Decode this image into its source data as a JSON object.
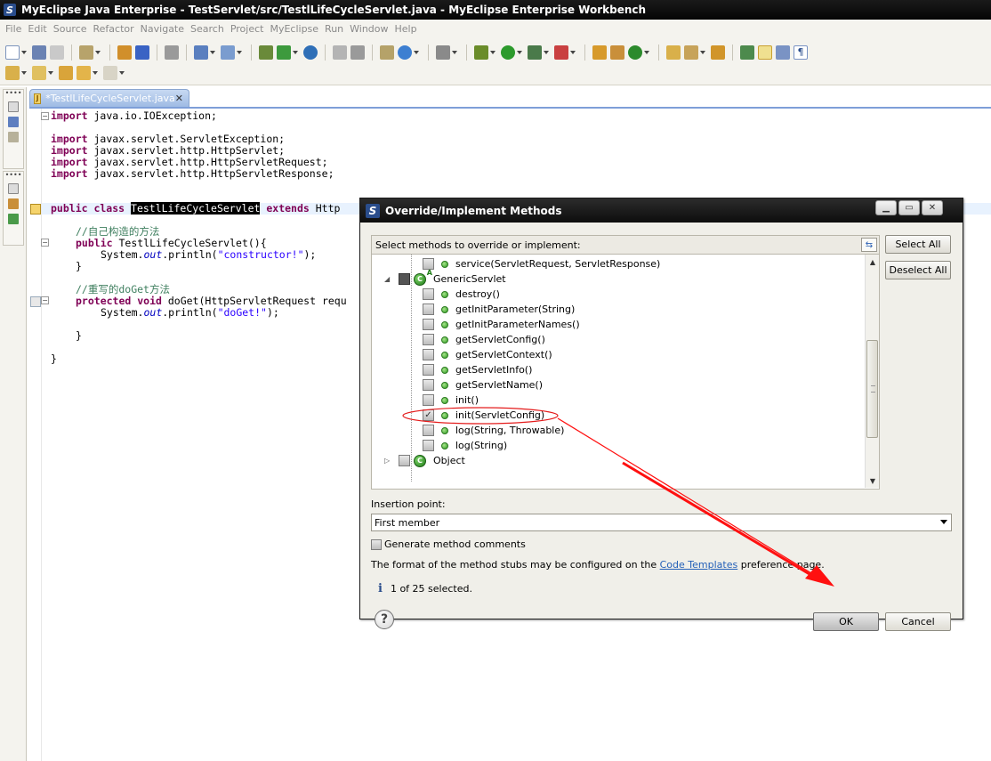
{
  "window": {
    "title": "MyEclipse Java Enterprise - TestServlet/src/TestlLifeCycleServlet.java - MyEclipse Enterprise Workbench"
  },
  "menu": [
    "File",
    "Edit",
    "Source",
    "Refactor",
    "Navigate",
    "Search",
    "Project",
    "MyEclipse",
    "Run",
    "Window",
    "Help"
  ],
  "editor": {
    "tab_label": "*TestlLifeCycleServlet.java",
    "code": {
      "l1_kw": "import",
      "l1_rest": " java.io.IOException;",
      "l3_kw": "import",
      "l3_rest": " javax.servlet.ServletException;",
      "l4_kw": "import",
      "l4_rest": " javax.servlet.http.HttpServlet;",
      "l5_kw": "import",
      "l5_rest": " javax.servlet.http.HttpServletRequest;",
      "l6_kw": "import",
      "l6_rest": " javax.servlet.http.HttpServletResponse;",
      "l8_kw1": "public class ",
      "l8_cls": "TestlLifeCycleServlet",
      "l8_kw2": " extends",
      "l8_rest": " Http",
      "l10_cm": "//自己构造的方法",
      "l11_kw": "public",
      "l11_rest": " TestlLifeCycleServlet(){",
      "l12_a": "System.",
      "l12_it": "out",
      "l12_b": ".println(",
      "l12_str": "\"constructor!\"",
      "l12_c": ");",
      "l13": "}",
      "l15_cm": "//重写的doGet方法",
      "l16_kw": "protected void",
      "l16_rest": " doGet(HttpServletRequest requ",
      "l17_a": "System.",
      "l17_it": "out",
      "l17_b": ".println(",
      "l17_str": "\"doGet!\"",
      "l17_c": ");",
      "l19": "}",
      "l21": "}"
    }
  },
  "dialog": {
    "title": "Override/Implement Methods",
    "select_label": "Select methods to override or implement:",
    "select_all": "Select All",
    "deselect_all": "Deselect All",
    "tree": [
      {
        "label": "service(ServletRequest, ServletResponse)",
        "checked": false
      },
      {
        "label": "GenericServlet",
        "type": "class"
      },
      {
        "label": "destroy()",
        "checked": false
      },
      {
        "label": "getInitParameter(String)",
        "checked": false
      },
      {
        "label": "getInitParameterNames()",
        "checked": false
      },
      {
        "label": "getServletConfig()",
        "checked": false
      },
      {
        "label": "getServletContext()",
        "checked": false
      },
      {
        "label": "getServletInfo()",
        "checked": false
      },
      {
        "label": "getServletName()",
        "checked": false
      },
      {
        "label": "init()",
        "checked": false
      },
      {
        "label": "init(ServletConfig)",
        "checked": true
      },
      {
        "label": "log(String, Throwable)",
        "checked": false
      },
      {
        "label": "log(String)",
        "checked": false
      },
      {
        "label": "Object",
        "type": "class"
      }
    ],
    "insertion_label": "Insertion point:",
    "insertion_value": "First member",
    "generate_comments": "Generate method comments",
    "format_prefix": "The format of the method stubs may be configured on the ",
    "format_link": "Code Templates",
    "format_suffix": " preference page.",
    "status": "1 of 25 selected.",
    "ok": "OK",
    "cancel": "Cancel"
  },
  "colors": {
    "accent": "#ff0000",
    "keyword": "#7f0055",
    "comment": "#3f7f5f",
    "string": "#2a00ff"
  }
}
